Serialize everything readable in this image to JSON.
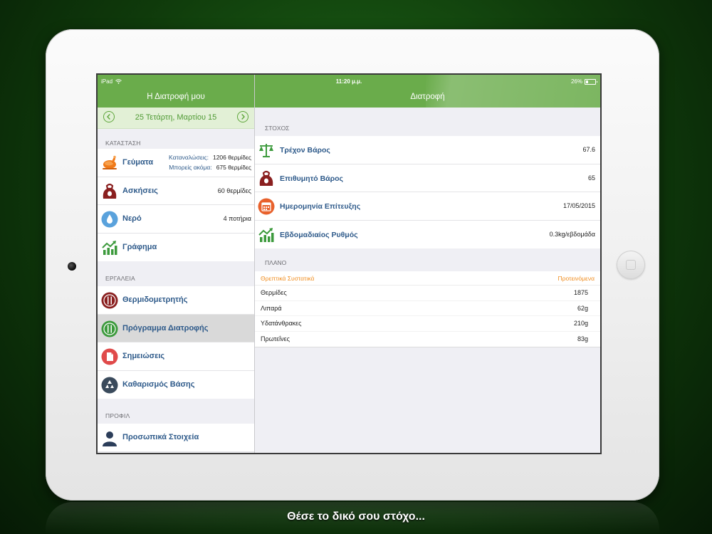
{
  "status": {
    "device": "iPad",
    "time": "11:20 μ.μ.",
    "battery": "26%"
  },
  "left": {
    "title": "Η Διατροφή μου",
    "date": "25 Τετάρτη, Μαρτίου 15",
    "sections": {
      "status": "ΚΑΤΑΣΤΑΣΗ",
      "tools": "ΕΡΓΑΛΕΙΑ",
      "profile": "ΠΡΟΦΙΛ"
    },
    "meals": {
      "label": "Γεύματα",
      "consumed_label": "Καταναλώσεις:",
      "consumed_value": "1206 θερμίδες",
      "remaining_label": "Μπορείς ακόμα:",
      "remaining_value": "675 θερμίδες"
    },
    "exercise": {
      "label": "Ασκήσεις",
      "value": "60 θερμίδες"
    },
    "water": {
      "label": "Νερό",
      "value": "4 ποτήρια"
    },
    "graph": {
      "label": "Γράφημα"
    },
    "tools": [
      {
        "label": "Θερμιδομετρητής"
      },
      {
        "label": "Πρόγραμμα Διατροφής"
      },
      {
        "label": "Σημειώσεις"
      },
      {
        "label": "Καθαρισμός Βάσης"
      }
    ],
    "profile_item": {
      "label": "Προσωπικά Στοιχεία"
    }
  },
  "right": {
    "title": "Διατροφή",
    "goal_header": "ΣΤΟΧΟΣ",
    "goals": [
      {
        "label": "Τρέχον Βάρος",
        "value": "67.6"
      },
      {
        "label": "Επιθυμητό Βάρος",
        "value": "65"
      },
      {
        "label": "Ημερομηνία Επίτευξης",
        "value": "17/05/2015"
      },
      {
        "label": "Εβδομαδιαίος Ρυθμός",
        "value": "0.3kg/εβδομάδα"
      }
    ],
    "plan_header": "ΠΛΑΝΟ",
    "plan_columns": {
      "nutrient": "Θρεπτικά Συστατικά",
      "recommended": "Προτεινόμενα"
    },
    "plan_rows": [
      {
        "name": "Θερμίδες",
        "value": "1875"
      },
      {
        "name": "Λιπαρά",
        "value": "62g"
      },
      {
        "name": "Υδατάνθρακες",
        "value": "210g"
      },
      {
        "name": "Πρωτεΐνες",
        "value": "83g"
      }
    ]
  },
  "caption": "Θέσε το δικό σου στόχο...",
  "colors": {
    "accent": "#6aac4b",
    "label": "#2e5a8a",
    "plan_header": "#f08c1e"
  }
}
